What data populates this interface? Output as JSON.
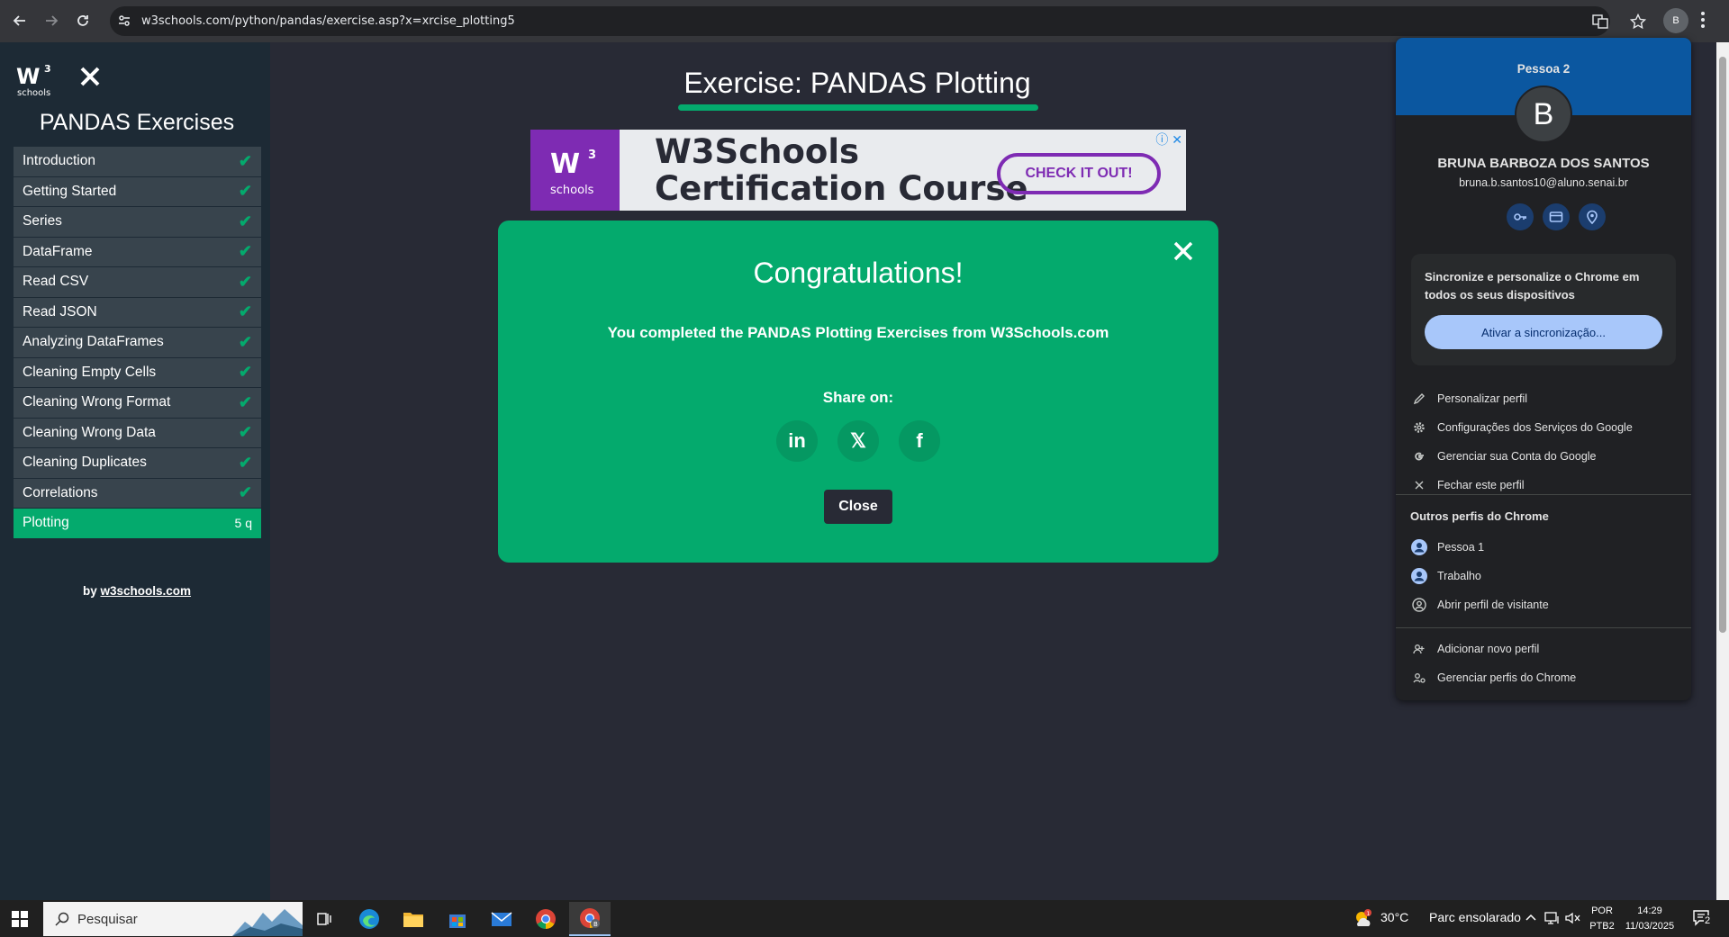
{
  "browser": {
    "url": "w3schools.com/python/pandas/exercise.asp?x=xrcise_plotting5",
    "profile_initial": "B"
  },
  "sidebar": {
    "logo_text": "schools",
    "logo_super": "3",
    "title": "PANDAS Exercises",
    "items": [
      {
        "label": "Introduction",
        "status": "✔"
      },
      {
        "label": "Getting Started",
        "status": "✔"
      },
      {
        "label": "Series",
        "status": "✔"
      },
      {
        "label": "DataFrame",
        "status": "✔"
      },
      {
        "label": "Read CSV",
        "status": "✔"
      },
      {
        "label": "Read JSON",
        "status": "✔"
      },
      {
        "label": "Analyzing DataFrames",
        "status": "✔"
      },
      {
        "label": "Cleaning Empty Cells",
        "status": "✔"
      },
      {
        "label": "Cleaning Wrong Format",
        "status": "✔"
      },
      {
        "label": "Cleaning Wrong Data",
        "status": "✔"
      },
      {
        "label": "Cleaning Duplicates",
        "status": "✔"
      },
      {
        "label": "Correlations",
        "status": "✔"
      },
      {
        "label": "Plotting",
        "status": "5 q"
      }
    ],
    "by_prefix": "by",
    "by_link": "w3schools.com"
  },
  "main": {
    "title": "Exercise: PANDAS Plotting"
  },
  "ad": {
    "logo_text": "schools",
    "logo_super": "3",
    "line1": "W3Schools",
    "line2": "Certification Course",
    "cta": "CHECK IT OUT!",
    "close": "ⓘ ✕"
  },
  "modal": {
    "title": "Congratulations!",
    "message": "You completed the PANDAS Plotting Exercises from W3Schools.com",
    "share_label": "Share on:",
    "share": [
      "in",
      "𝕏",
      "f"
    ],
    "close_label": "Close"
  },
  "profile": {
    "header_name": "Pessoa 2",
    "initial": "B",
    "full_name": "BRUNA BARBOZA DOS SANTOS",
    "email": "bruna.b.santos10@aluno.senai.br",
    "sync_text": "Sincronize e personalize o Chrome em todos os seus dispositivos",
    "sync_button": "Ativar a sincronização...",
    "menu": [
      {
        "icon": "pencil-icon",
        "label": "Personalizar perfil"
      },
      {
        "icon": "gear-icon",
        "label": "Configurações dos Serviços do Google"
      },
      {
        "icon": "google-icon",
        "label": "Gerenciar sua Conta do Google"
      },
      {
        "icon": "close-icon",
        "label": "Fechar este perfil"
      }
    ],
    "others_title": "Outros perfis do Chrome",
    "others": [
      {
        "label": "Pessoa 1"
      },
      {
        "label": "Trabalho"
      },
      {
        "label": "Abrir perfil de visitante"
      }
    ],
    "bottom": [
      {
        "label": "Adicionar novo perfil"
      },
      {
        "label": "Gerenciar perfis do Chrome"
      }
    ]
  },
  "taskbar": {
    "search_placeholder": "Pesquisar",
    "weather_temp": "30°C",
    "weather_desc": "Parc ensolarado",
    "lang1": "POR",
    "lang2": "PTB2",
    "time": "14:29",
    "date": "11/03/2025",
    "notif_count": "2"
  }
}
